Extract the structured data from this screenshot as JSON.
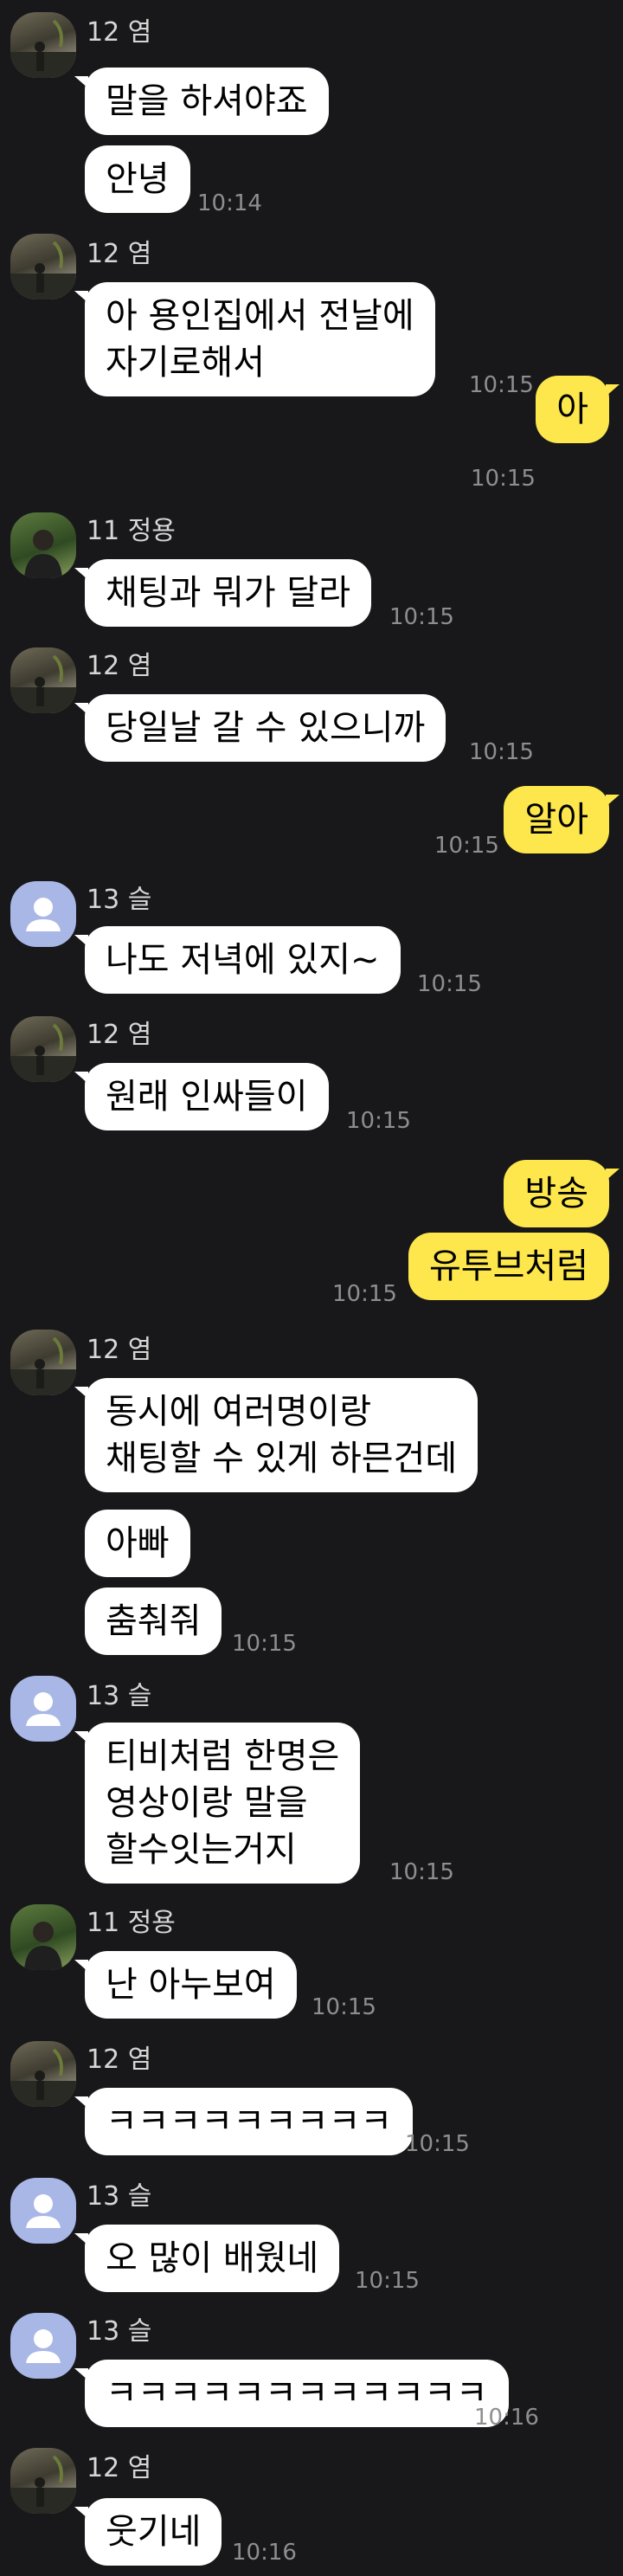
{
  "senders": {
    "yeom": "12 염",
    "jeongyong": "11 정용",
    "seul": "13 슬"
  },
  "messages": {
    "m1": "말을 하셔야죠",
    "m2": "안녕",
    "m2_time": "10:14",
    "m3": "아 용인집에서 전날에\n자기로해서",
    "m3_time": "10:15",
    "m4": "아",
    "m4_time": "10:15",
    "m5": "채팅과 뭐가 달라",
    "m5_time": "10:15",
    "m6": "당일날 갈 수 있으니까",
    "m6_time": "10:15",
    "m7": "알아",
    "m7_time": "10:15",
    "m8": "나도 저녁에 있지~",
    "m8_time": "10:15",
    "m9": "원래 인싸들이",
    "m9_time": "10:15",
    "m10": "방송",
    "m11": "유투브처럼",
    "m11_time": "10:15",
    "m12": "동시에 여러명이랑\n채팅할 수 있게 하믄건데",
    "m13": "아빠",
    "m14": "춤춰줘",
    "m14_time": "10:15",
    "m15": "티비처럼 한명은\n영상이랑 말을\n할수잇는거지",
    "m15_time": "10:15",
    "m16": "난 아누보여",
    "m16_time": "10:15",
    "m17": "ㅋㅋㅋㅋㅋㅋㅋㅋㅋ",
    "m17_time": "10:15",
    "m18": "오 많이 배웠네",
    "m18_time": "10:15",
    "m19": "ㅋㅋㅋㅋㅋㅋㅋㅋㅋㅋㅋㅋ",
    "m19_time": "10:16",
    "m20": "웃기네",
    "m20_time": "10:16"
  },
  "icons": {
    "avatar_yeom": "profile-photo-icon",
    "avatar_jeongyong": "profile-photo-icon",
    "avatar_seul": "default-person-icon"
  },
  "colors": {
    "background": "#18181a",
    "incoming_bubble": "#ffffff",
    "outgoing_bubble": "#fde74c",
    "timestamp": "#8e8e8e",
    "sender_name": "#d6d6d6"
  }
}
